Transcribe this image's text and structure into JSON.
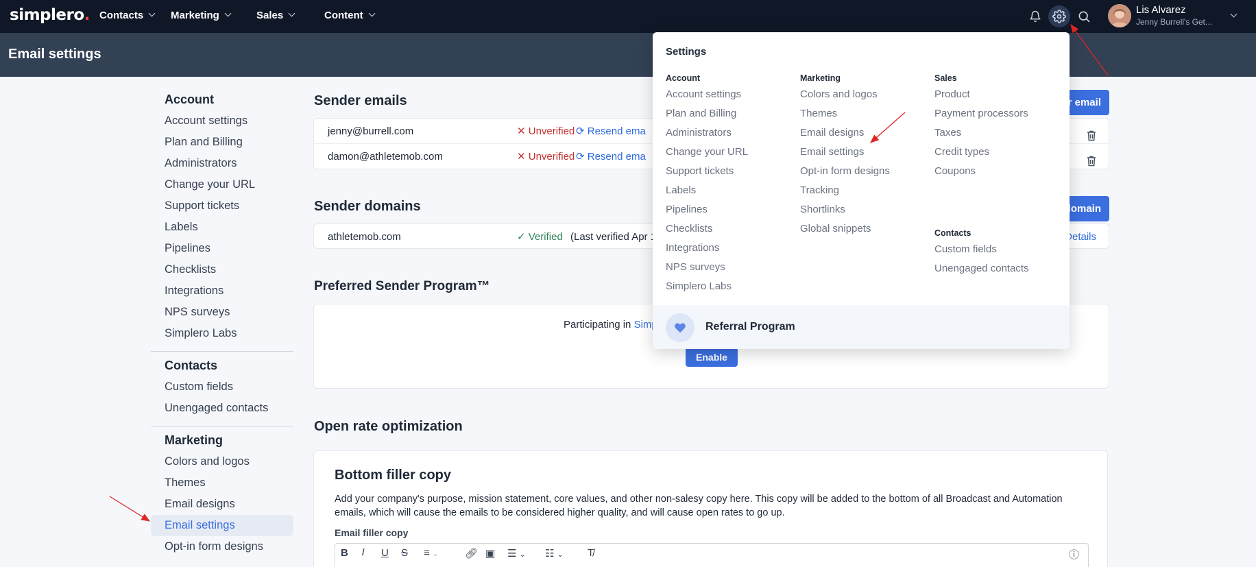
{
  "topnav": {
    "logo": "simplero",
    "logo_dot": ".",
    "items": [
      {
        "label": "Contacts"
      },
      {
        "label": "Marketing"
      },
      {
        "label": "Sales"
      },
      {
        "label": "Content"
      }
    ],
    "icons": [
      "bell-icon",
      "gear-icon",
      "search-icon"
    ],
    "user": {
      "name": "Lis Alvarez",
      "subtitle": "Jenny Burrell's Get..."
    }
  },
  "page": {
    "title": "Email settings"
  },
  "sidebar": {
    "groups": [
      {
        "title": "Account",
        "items": [
          "Account settings",
          "Plan and Billing",
          "Administrators",
          "Change your URL",
          "Support tickets",
          "Labels",
          "Pipelines",
          "Checklists",
          "Integrations",
          "NPS surveys",
          "Simplero Labs"
        ]
      },
      {
        "title": "Contacts",
        "items": [
          "Custom fields",
          "Unengaged contacts"
        ]
      },
      {
        "title": "Marketing",
        "items": [
          "Colors and logos",
          "Themes",
          "Email designs",
          "Email settings",
          "Opt-in form designs"
        ]
      }
    ],
    "active": "Email settings"
  },
  "sender_emails": {
    "title": "Sender emails",
    "add_button": "r email",
    "rows": [
      {
        "email": "jenny@burrell.com",
        "status": "Unverified",
        "action": "Resend ema"
      },
      {
        "email": "damon@athletemob.com",
        "status": "Unverified",
        "action": "Resend ema"
      }
    ]
  },
  "sender_domains": {
    "title": "Sender domains",
    "add_button": "domain",
    "rows": [
      {
        "domain": "athletemob.com",
        "status": "Verified",
        "note": "(Last verified Apr 1",
        "details": "Details"
      }
    ]
  },
  "preferred_sender": {
    "title": "Preferred Sender Program™",
    "text_prefix": "Participating in",
    "link": "Simp",
    "button": "Enable"
  },
  "open_rate": {
    "title": "Open rate optimization",
    "card_title": "Bottom filler copy",
    "description": "Add your company's purpose, mission statement, core values, and other non-salesy copy here. This copy will be added to the bottom of all Broadcast and Automation emails, which will cause the emails to be considered higher quality, and will cause open rates to go up.",
    "field_label": "Email filler copy"
  },
  "settings_dropdown": {
    "title": "Settings",
    "columns": [
      {
        "heading": "Account",
        "items": [
          "Account settings",
          "Plan and Billing",
          "Administrators",
          "Change your URL",
          "Support tickets",
          "Labels",
          "Pipelines",
          "Checklists",
          "Integrations",
          "NPS surveys",
          "Simplero Labs"
        ]
      },
      {
        "heading": "Marketing",
        "items": [
          "Colors and logos",
          "Themes",
          "Email designs",
          "Email settings",
          "Opt-in form designs",
          "Tracking",
          "Shortlinks",
          "Global snippets"
        ]
      },
      {
        "heading": "Sales",
        "items": [
          "Product",
          "Payment processors",
          "Taxes",
          "Credit types",
          "Coupons"
        ]
      },
      {
        "heading": "Contacts",
        "items": [
          "Custom fields",
          "Unengaged contacts"
        ]
      }
    ],
    "footer": "Referral Program"
  },
  "colors": {
    "nav_bg": "#101827",
    "header_bg": "#334155",
    "accent": "#3b6fe0",
    "error": "#c53030",
    "success": "#2f855a",
    "annotation_arrow": "#e02424"
  }
}
